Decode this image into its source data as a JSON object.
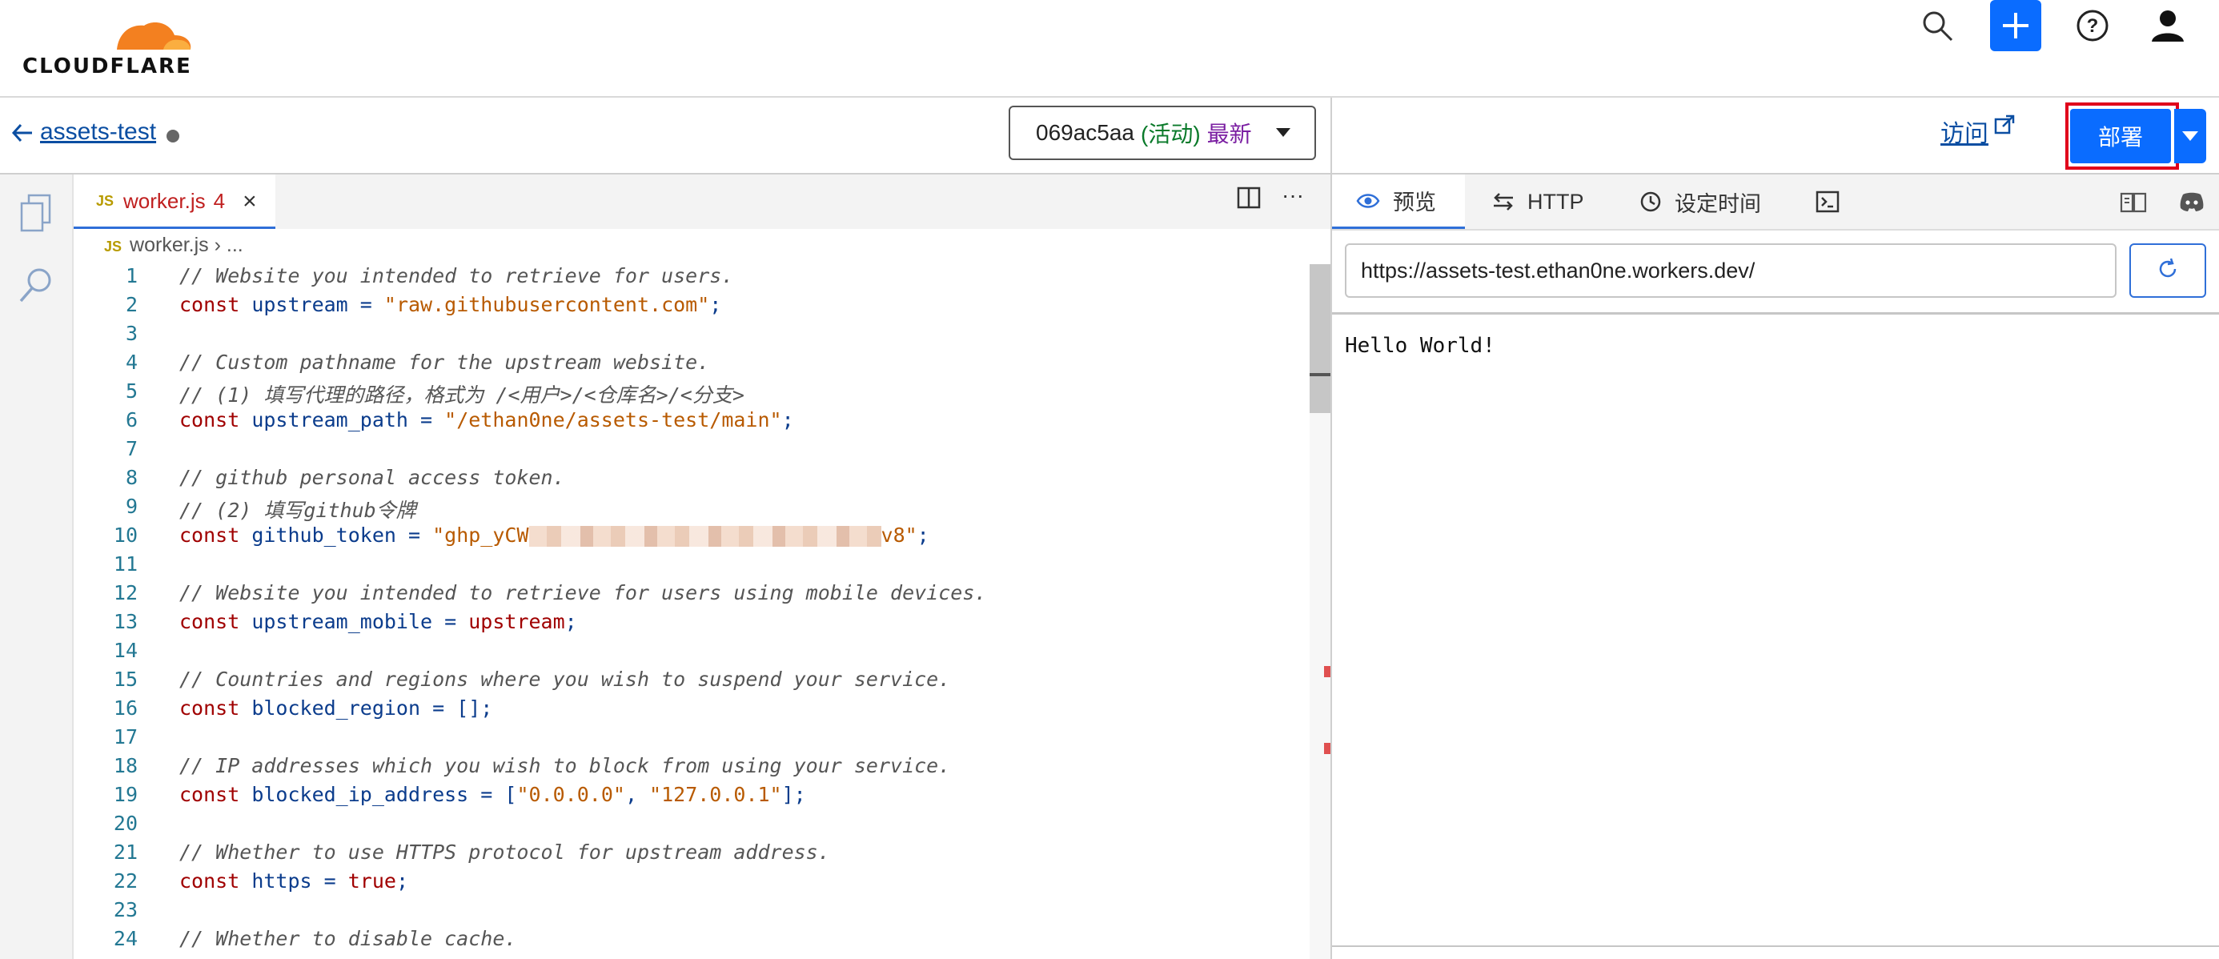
{
  "header": {
    "logo_text": "CLOUDFLARE",
    "brand_color": "#f38020",
    "icons": [
      "search-icon",
      "plus-icon",
      "help-icon",
      "user-icon"
    ]
  },
  "subbar": {
    "project_name": "assets-test",
    "version": {
      "id": "069ac5aa",
      "status": "(活动)",
      "tag": "最新"
    },
    "visit_label": "访问",
    "deploy_label": "部署"
  },
  "editor": {
    "tab": {
      "filename": "worker.js",
      "problem_count": "4",
      "badge": "JS"
    },
    "breadcrumb": {
      "file": "worker.js",
      "rest": "..."
    },
    "lines": [
      {
        "n": "1",
        "parts": [
          {
            "t": "// Website you intended to retrieve for users.",
            "c": "com"
          }
        ]
      },
      {
        "n": "2",
        "parts": [
          {
            "t": "const ",
            "c": "kw"
          },
          {
            "t": "upstream",
            "c": "id"
          },
          {
            "t": " = ",
            "c": "op"
          },
          {
            "t": "\"raw.githubusercontent.com\"",
            "c": "str"
          },
          {
            "t": ";",
            "c": "pun"
          }
        ]
      },
      {
        "n": "3",
        "parts": []
      },
      {
        "n": "4",
        "parts": [
          {
            "t": "// Custom pathname for the upstream website.",
            "c": "com"
          }
        ]
      },
      {
        "n": "5",
        "parts": [
          {
            "t": "// (1) 填写代理的路径，格式为 /<用户>/<仓库名>/<分支>",
            "c": "com"
          }
        ]
      },
      {
        "n": "6",
        "parts": [
          {
            "t": "const ",
            "c": "kw"
          },
          {
            "t": "upstream_path",
            "c": "id"
          },
          {
            "t": " = ",
            "c": "op"
          },
          {
            "t": "\"/ethan0ne/assets-test/main\"",
            "c": "str"
          },
          {
            "t": ";",
            "c": "pun"
          }
        ]
      },
      {
        "n": "7",
        "parts": []
      },
      {
        "n": "8",
        "parts": [
          {
            "t": "// github personal access token.",
            "c": "com"
          }
        ]
      },
      {
        "n": "9",
        "parts": [
          {
            "t": "// (2) 填写github令牌",
            "c": "com"
          }
        ]
      },
      {
        "n": "10",
        "parts": [
          {
            "t": "const ",
            "c": "kw"
          },
          {
            "t": "github_token",
            "c": "id"
          },
          {
            "t": " = ",
            "c": "op"
          },
          {
            "t": "\"ghp_yCW",
            "c": "str"
          },
          {
            "t": "",
            "c": "blur"
          },
          {
            "t": "v8\"",
            "c": "str"
          },
          {
            "t": ";",
            "c": "pun"
          }
        ]
      },
      {
        "n": "11",
        "parts": []
      },
      {
        "n": "12",
        "parts": [
          {
            "t": "// Website you intended to retrieve for users using mobile devices.",
            "c": "com"
          }
        ]
      },
      {
        "n": "13",
        "parts": [
          {
            "t": "const ",
            "c": "kw"
          },
          {
            "t": "upstream_mobile",
            "c": "id"
          },
          {
            "t": " = ",
            "c": "op"
          },
          {
            "t": "upstream",
            "c": "kw"
          },
          {
            "t": ";",
            "c": "pun"
          }
        ]
      },
      {
        "n": "14",
        "parts": []
      },
      {
        "n": "15",
        "parts": [
          {
            "t": "// Countries and regions where you wish to suspend your service.",
            "c": "com"
          }
        ]
      },
      {
        "n": "16",
        "parts": [
          {
            "t": "const ",
            "c": "kw"
          },
          {
            "t": "blocked_region",
            "c": "id"
          },
          {
            "t": " = ",
            "c": "op"
          },
          {
            "t": "[];",
            "c": "pun"
          }
        ]
      },
      {
        "n": "17",
        "parts": []
      },
      {
        "n": "18",
        "parts": [
          {
            "t": "// IP addresses which you wish to block from using your service.",
            "c": "com"
          }
        ]
      },
      {
        "n": "19",
        "parts": [
          {
            "t": "const ",
            "c": "kw"
          },
          {
            "t": "blocked_ip_address",
            "c": "id"
          },
          {
            "t": " = ",
            "c": "op"
          },
          {
            "t": "[",
            "c": "pun"
          },
          {
            "t": "\"0.0.0.0\"",
            "c": "str"
          },
          {
            "t": ", ",
            "c": "pun"
          },
          {
            "t": "\"127.0.0.1\"",
            "c": "str"
          },
          {
            "t": "];",
            "c": "pun"
          }
        ]
      },
      {
        "n": "20",
        "parts": []
      },
      {
        "n": "21",
        "parts": [
          {
            "t": "// Whether to use HTTPS protocol for upstream address.",
            "c": "com"
          }
        ]
      },
      {
        "n": "22",
        "parts": [
          {
            "t": "const ",
            "c": "kw"
          },
          {
            "t": "https",
            "c": "id"
          },
          {
            "t": " = ",
            "c": "op"
          },
          {
            "t": "true",
            "c": "kw"
          },
          {
            "t": ";",
            "c": "pun"
          }
        ]
      },
      {
        "n": "23",
        "parts": []
      },
      {
        "n": "24",
        "parts": [
          {
            "t": "// Whether to disable cache.",
            "c": "com"
          }
        ]
      }
    ]
  },
  "preview": {
    "tabs": [
      {
        "label": "预览",
        "icon": "eye-icon",
        "name": "tab-preview"
      },
      {
        "label": "HTTP",
        "icon": "arrows-icon",
        "name": "tab-http"
      },
      {
        "label": "设定时间",
        "icon": "clock-icon",
        "name": "tab-schedule"
      }
    ],
    "url": "https://assets-test.ethan0ne.workers.dev/",
    "body_text": "Hello World!"
  }
}
